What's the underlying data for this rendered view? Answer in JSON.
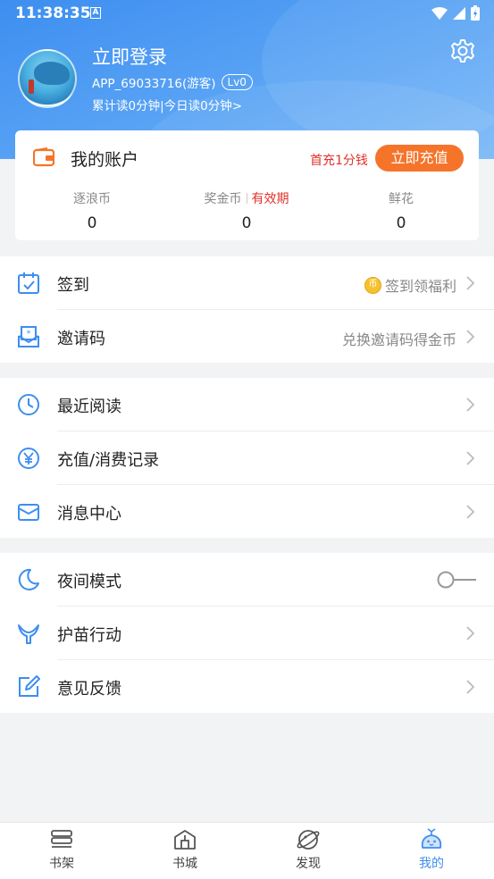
{
  "status_bar": {
    "time": "11:38:35",
    "sim_indicator": "A"
  },
  "profile": {
    "login_title": "立即登录",
    "user_id": "APP_69033716(游客)",
    "level": "Lv0",
    "read_stats": "累计读0分钟|今日读0分钟>"
  },
  "account": {
    "title": "我的账户",
    "promo": "首充1分钱",
    "recharge_label": "立即充值",
    "stats": [
      {
        "label": "逐浪币",
        "value": "0"
      },
      {
        "label": "奖金币",
        "sub_label": "有效期",
        "value": "0"
      },
      {
        "label": "鲜花",
        "value": "0"
      }
    ]
  },
  "menu_group_1": [
    {
      "label": "签到",
      "hint": "签到领福利",
      "coin_glyph": "币",
      "icon": "calendar-check-icon"
    },
    {
      "label": "邀请码",
      "hint": "兑换邀请码得金币",
      "icon": "invite-mail-icon"
    }
  ],
  "menu_group_2": [
    {
      "label": "最近阅读",
      "icon": "clock-icon"
    },
    {
      "label": "充值/消费记录",
      "icon": "yen-icon"
    },
    {
      "label": "消息中心",
      "icon": "mail-icon"
    }
  ],
  "menu_group_3": [
    {
      "label": "夜间模式",
      "icon": "moon-icon",
      "toggle_on": false
    },
    {
      "label": "护苗行动",
      "icon": "whale-tail-icon"
    },
    {
      "label": "意见反馈",
      "icon": "edit-icon"
    }
  ],
  "tabs": [
    {
      "label": "书架",
      "icon": "bookshelf-icon",
      "active": false
    },
    {
      "label": "书城",
      "icon": "store-icon",
      "active": false
    },
    {
      "label": "发现",
      "icon": "planet-icon",
      "active": false
    },
    {
      "label": "我的",
      "icon": "mascot-icon",
      "active": true
    }
  ],
  "colors": {
    "primary": "#3d8ef0",
    "accent_orange": "#f5742a",
    "accent_red": "#e0322b"
  }
}
